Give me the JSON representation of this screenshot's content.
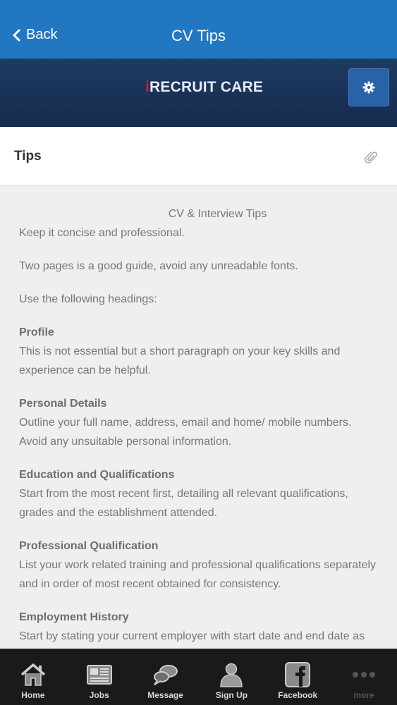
{
  "nav": {
    "back_label": "Back",
    "title": "CV Tips"
  },
  "brand": {
    "logo_prefix": "i",
    "logo_text": "RECRUIT CARE"
  },
  "section": {
    "title": "Tips"
  },
  "content": {
    "heading": "CV & Interview Tips",
    "p1": "Keep it concise and professional.",
    "p2": "Two pages is a good guide, avoid any unreadable fonts.",
    "p3": "Use the following headings:",
    "s1_title": "Profile",
    "s1_text": "This is not essential but a short paragraph on your key skills and experience can be helpful.",
    "s2_title": "Personal Details",
    "s2_text": "Outline your full name, address, email and home/ mobile numbers. Avoid any unsuitable personal information.",
    "s3_title": "Education and Qualifications",
    "s3_text": "Start from the most recent first, detailing all relevant qualifications, grades and the establishment attended.",
    "s4_title": "Professional Qualification",
    "s4_text": "List your work related training and professional qualifications separately and in order of most recent obtained for consistency.",
    "s5_title": "Employment History",
    "s5_text": "Start by stating your current employer with start date and end date as"
  },
  "tabs": [
    {
      "label": "Home",
      "icon": "home-icon"
    },
    {
      "label": "Jobs",
      "icon": "newspaper-icon"
    },
    {
      "label": "Message",
      "icon": "speech-bubbles-icon"
    },
    {
      "label": "Sign Up",
      "icon": "person-icon"
    },
    {
      "label": "Facebook",
      "icon": "facebook-icon"
    },
    {
      "label": "more",
      "icon": "more-dots-icon"
    }
  ],
  "colors": {
    "navbar": "#2277c3",
    "brandbar": "#1f3a63",
    "logo_accent": "#d3202a",
    "tabbar": "#1a1a1a"
  }
}
